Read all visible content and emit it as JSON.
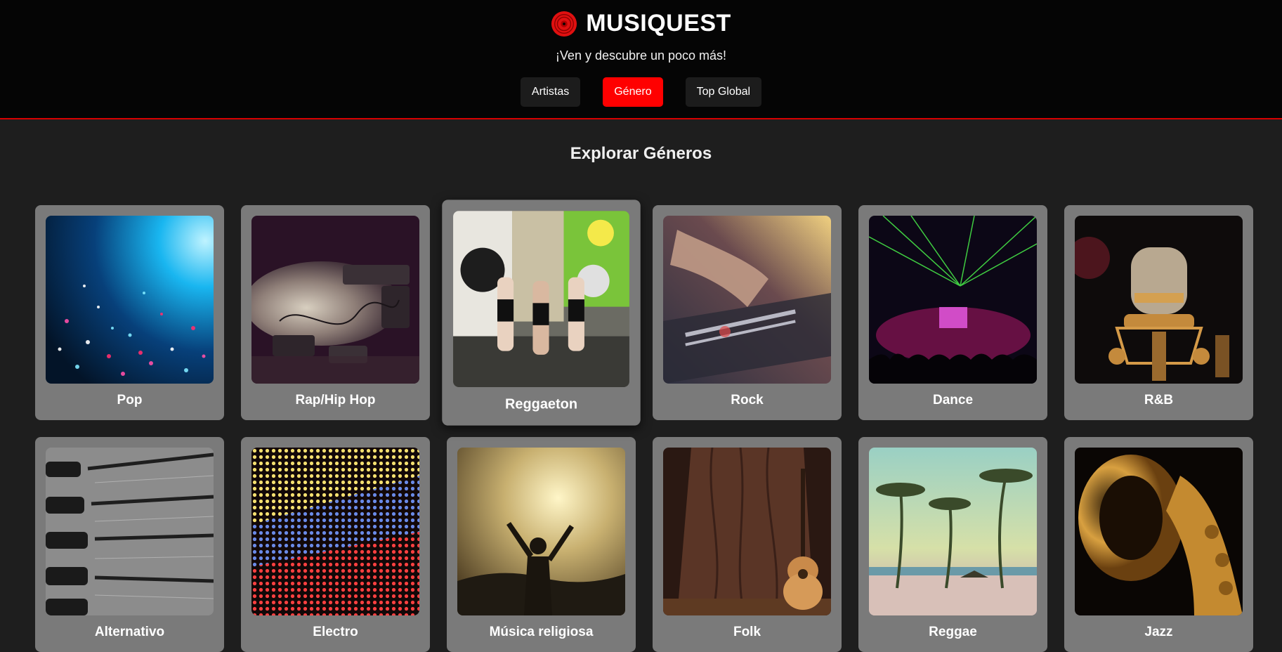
{
  "header": {
    "brand_title": "MUSIQUEST",
    "tagline": "¡Ven y descubre un poco más!",
    "logo_icon": "vinyl-record-icon",
    "accent_color": "#ff0000"
  },
  "nav": {
    "artists_label": "Artistas",
    "genre_label": "Género",
    "top_label": "Top Global",
    "active": "Género"
  },
  "main": {
    "section_title": "Explorar Géneros",
    "genres": [
      {
        "label": "Pop"
      },
      {
        "label": "Rap/Hip Hop"
      },
      {
        "label": "Reggaeton"
      },
      {
        "label": "Rock"
      },
      {
        "label": "Dance"
      },
      {
        "label": "R&B"
      },
      {
        "label": "Alternativo"
      },
      {
        "label": "Electro"
      },
      {
        "label": "Música religiosa"
      },
      {
        "label": "Folk"
      },
      {
        "label": "Reggae"
      },
      {
        "label": "Jazz"
      }
    ]
  }
}
